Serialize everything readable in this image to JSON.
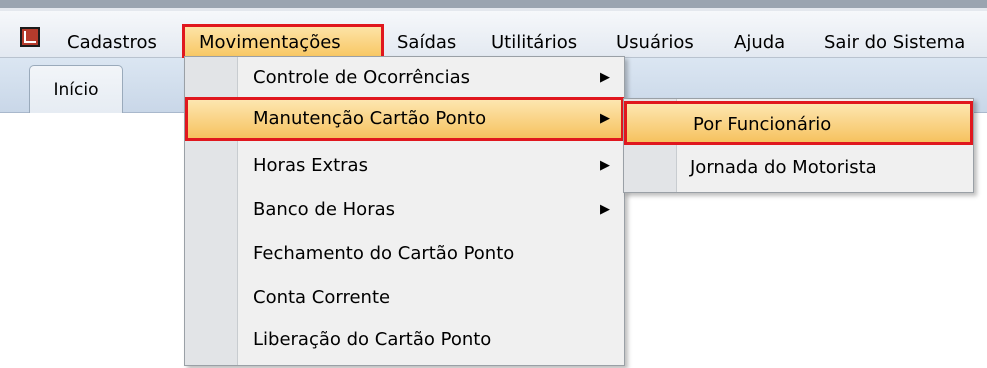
{
  "menubar": {
    "items": [
      {
        "label": "Cadastros"
      },
      {
        "label": "Movimentações"
      },
      {
        "label": "Saídas"
      },
      {
        "label": "Utilitários"
      },
      {
        "label": "Usuários"
      },
      {
        "label": "Ajuda"
      },
      {
        "label": "Sair do Sistema"
      }
    ],
    "active": "Movimentações"
  },
  "tabs": [
    {
      "label": "Início"
    }
  ],
  "dropdown": {
    "items": [
      {
        "label": "Controle de Ocorrências",
        "has_submenu": true
      },
      {
        "label": "Manutenção Cartão Ponto",
        "has_submenu": true
      },
      {
        "label": "Horas Extras",
        "has_submenu": true
      },
      {
        "label": "Banco de Horas",
        "has_submenu": true
      },
      {
        "label": "Fechamento do Cartão Ponto",
        "has_submenu": false
      },
      {
        "label": "Conta Corrente",
        "has_submenu": false
      },
      {
        "label": "Liberação do Cartão Ponto",
        "has_submenu": false
      }
    ],
    "highlighted": "Manutenção Cartão Ponto"
  },
  "submenu": {
    "items": [
      {
        "label": "Por Funcionário"
      },
      {
        "label": "Jornada do Motorista"
      }
    ],
    "highlighted": "Por Funcionário"
  },
  "colors": {
    "highlight_border": "#e0171e",
    "highlight_fill": "#f7c35a",
    "menubar_bg": "#e3e9f1"
  }
}
